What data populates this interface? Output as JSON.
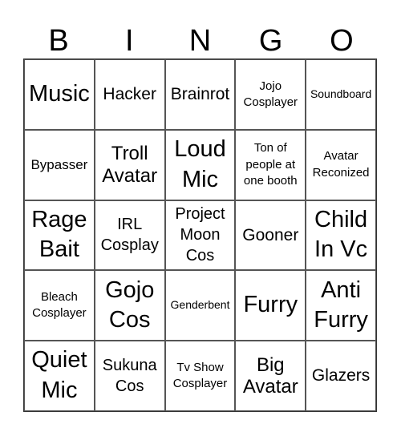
{
  "header": {
    "letters": [
      "B",
      "I",
      "N",
      "G",
      "O"
    ]
  },
  "card": {
    "cells": [
      {
        "text": "Music",
        "size": "s-xl"
      },
      {
        "text": "Hacker",
        "size": "s-m"
      },
      {
        "text": "Brainrot",
        "size": "s-m"
      },
      {
        "text": "Jojo Cosplayer",
        "size": "s-xs"
      },
      {
        "text": "Soundboard",
        "size": "s-xxs"
      },
      {
        "text": "Bypasser",
        "size": "s-s"
      },
      {
        "text": "Troll Avatar",
        "size": "s-l"
      },
      {
        "text": "Loud Mic",
        "size": "s-xl"
      },
      {
        "text": "Ton of people at one booth",
        "size": "s-xs"
      },
      {
        "text": "Avatar Reconized",
        "size": "s-xs"
      },
      {
        "text": "Rage Bait",
        "size": "s-xl"
      },
      {
        "text": "IRL Cosplay",
        "size": "s-ms"
      },
      {
        "text": "Project Moon Cos",
        "size": "s-ms"
      },
      {
        "text": "Gooner",
        "size": "s-m"
      },
      {
        "text": "Child In Vc",
        "size": "s-xl"
      },
      {
        "text": "Bleach Cosplayer",
        "size": "s-xs"
      },
      {
        "text": "Gojo Cos",
        "size": "s-xl"
      },
      {
        "text": "Genderbent",
        "size": "s-xxs"
      },
      {
        "text": "Furry",
        "size": "s-xl"
      },
      {
        "text": "Anti Furry",
        "size": "s-xl"
      },
      {
        "text": "Quiet Mic",
        "size": "s-xl"
      },
      {
        "text": "Sukuna Cos",
        "size": "s-ms"
      },
      {
        "text": "Tv Show Cosplayer",
        "size": "s-xs"
      },
      {
        "text": "Big Avatar",
        "size": "s-l"
      },
      {
        "text": "Glazers",
        "size": "s-m"
      }
    ]
  }
}
